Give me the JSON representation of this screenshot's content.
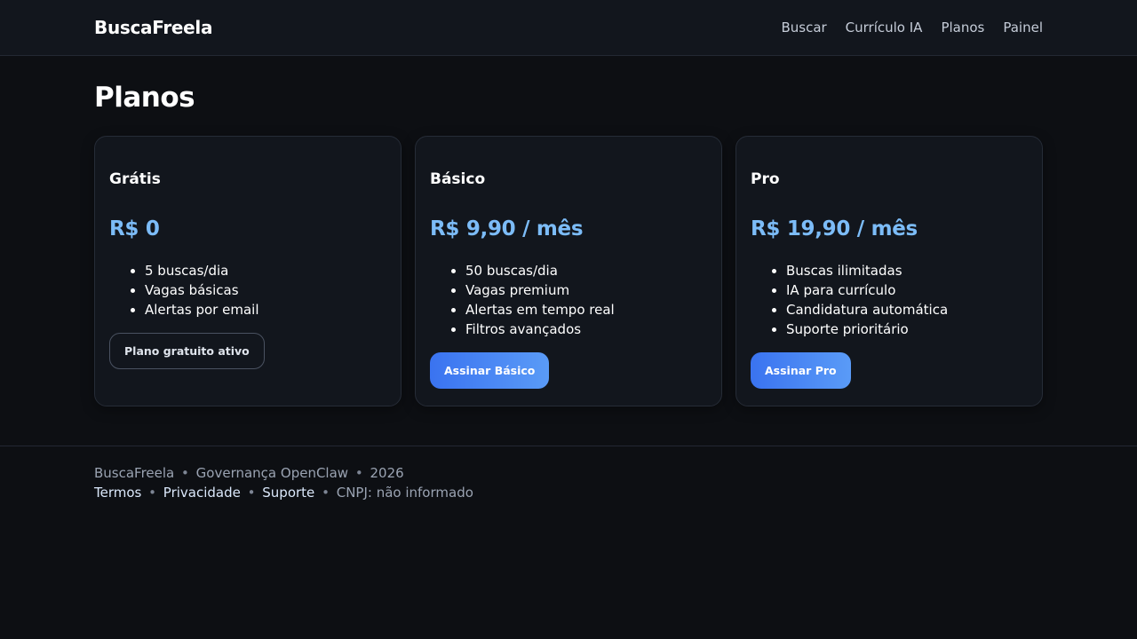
{
  "header": {
    "brand": "BuscaFreela",
    "nav": [
      "Buscar",
      "Currículo IA",
      "Planos",
      "Painel"
    ]
  },
  "main": {
    "title": "Planos",
    "plans": [
      {
        "name": "Grátis",
        "price": "R$ 0",
        "features": [
          "5 buscas/dia",
          "Vagas básicas",
          "Alertas por email"
        ],
        "button": "Plano gratuito ativo"
      },
      {
        "name": "Básico",
        "price": "R$ 9,90 / mês",
        "features": [
          "50 buscas/dia",
          "Vagas premium",
          "Alertas em tempo real",
          "Filtros avançados"
        ],
        "button": "Assinar Básico"
      },
      {
        "name": "Pro",
        "price": "R$ 19,90 / mês",
        "features": [
          "Buscas ilimitadas",
          "IA para currículo",
          "Candidatura automática",
          "Suporte prioritário"
        ],
        "button": "Assinar Pro"
      }
    ]
  },
  "footer": {
    "brand": "BuscaFreela",
    "governance": "Governança OpenClaw",
    "year": "2026",
    "links": [
      "Termos",
      "Privacidade",
      "Suporte"
    ],
    "cnpj": "CNPJ: não informado",
    "separator": "•"
  },
  "colors": {
    "background": "#0d0f13",
    "surface": "#12161d",
    "price_accent": "#7cbcf8",
    "primary_button_start": "#3a73f0",
    "primary_button_end": "#5a9bf7"
  }
}
